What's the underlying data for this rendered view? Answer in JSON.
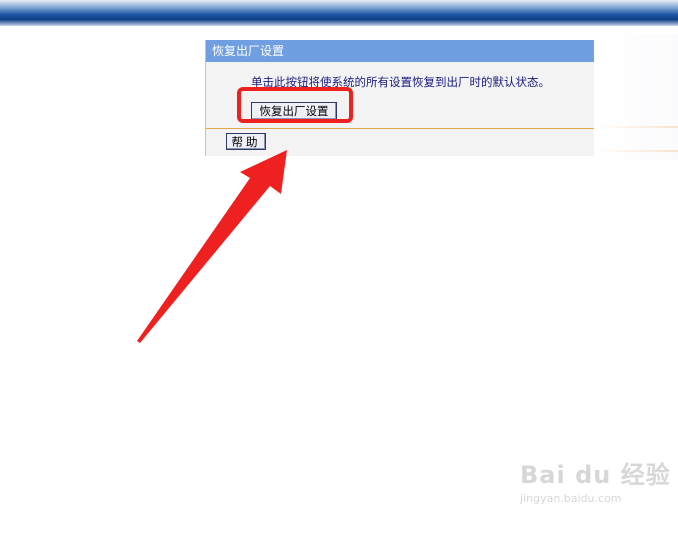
{
  "panel": {
    "title": "恢复出厂设置",
    "description": "单击此按钮将使系统的所有设置恢复到出厂时的默认状态。",
    "reset_button_label": "恢复出厂设置",
    "help_button_label": "帮助"
  },
  "watermark": {
    "logo_text": "Bai du 经验",
    "url": "jingyan.baidu.com"
  },
  "colors": {
    "header_bg": "#6f9fe0",
    "panel_bg": "#f3f3f3",
    "divider": "#e3a64a",
    "annotation_red": "#ee2020"
  },
  "icons": {
    "annotation_arrow": "red-arrow-icon",
    "watermark_paw": "paw-icon"
  }
}
